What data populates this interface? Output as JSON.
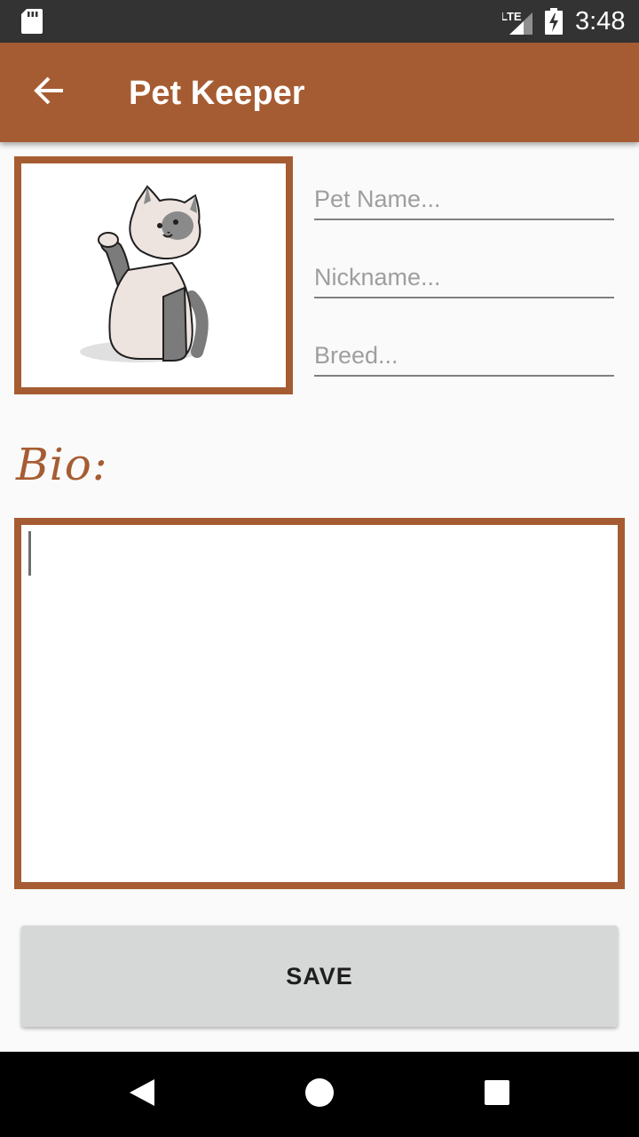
{
  "status_bar": {
    "time": "3:48",
    "network": "LTE",
    "icons": [
      "sd-card-icon",
      "signal-icon",
      "battery-charging-icon"
    ]
  },
  "app_bar": {
    "title": "Pet Keeper",
    "back_icon": "arrow-back-icon"
  },
  "pet_photo": {
    "icon": "cat-illustration"
  },
  "form": {
    "pet_name_placeholder": "Pet Name...",
    "pet_name_value": "",
    "nickname_placeholder": "Nickname...",
    "nickname_value": "",
    "breed_placeholder": "Breed...",
    "breed_value": ""
  },
  "bio": {
    "label": "Bio:",
    "value": ""
  },
  "actions": {
    "save_label": "SAVE"
  },
  "nav_bar": {
    "icons": [
      "nav-back-icon",
      "nav-home-icon",
      "nav-recents-icon"
    ]
  },
  "colors": {
    "accent": "#a65c32",
    "status_bar": "#333333",
    "button": "#d6d7d7",
    "background": "#fafafa"
  }
}
